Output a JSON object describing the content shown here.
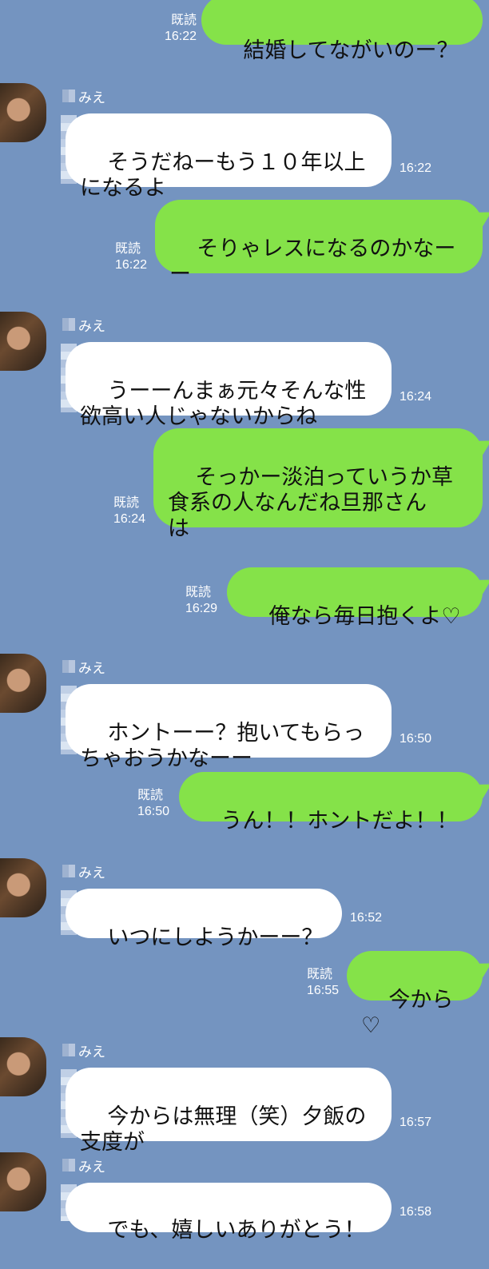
{
  "chat": {
    "read_label": "既読",
    "contact_name": "みえ",
    "messages": [
      {
        "id": "m1",
        "side": "sent",
        "text": "結婚してながいのー？",
        "time": "16:22",
        "read": true
      },
      {
        "id": "m2",
        "side": "recv",
        "text": "そうだねーもう１０年以上\nになるよ",
        "time": "16:22"
      },
      {
        "id": "m3",
        "side": "sent",
        "text": "そりゃレスになるのかなー\nー",
        "time": "16:22",
        "read": true
      },
      {
        "id": "m4",
        "side": "recv",
        "text": "うーーんまぁ元々そんな性\n欲高い人じゃないからね",
        "time": "16:24"
      },
      {
        "id": "m5",
        "side": "sent",
        "text": "そっかー淡泊っていうか草\n食系の人なんだね旦那さん\nは",
        "time": "16:24",
        "read": true
      },
      {
        "id": "m6",
        "side": "sent",
        "text": "俺なら毎日抱くよ♡",
        "time": "16:29",
        "read": true
      },
      {
        "id": "m7",
        "side": "recv",
        "text": "ホントーー？抱いてもらっ\nちゃおうかなーー",
        "time": "16:50"
      },
      {
        "id": "m8",
        "side": "sent",
        "text": "うん！！ホントだよ！！",
        "time": "16:50",
        "read": true
      },
      {
        "id": "m9",
        "side": "recv",
        "text": "いつにしようかーー？",
        "time": "16:52"
      },
      {
        "id": "m10",
        "side": "sent",
        "text": "今から♡",
        "time": "16:55",
        "read": true
      },
      {
        "id": "m11",
        "side": "recv",
        "text": "今からは無理（笑）夕飯の\n支度が",
        "time": "16:57"
      },
      {
        "id": "m12",
        "side": "recv",
        "text": "でも、嬉しいありがとう！",
        "time": "16:58"
      }
    ]
  },
  "colors": {
    "background": "#7494c0",
    "sent_bubble": "#85e249",
    "recv_bubble": "#ffffff"
  }
}
